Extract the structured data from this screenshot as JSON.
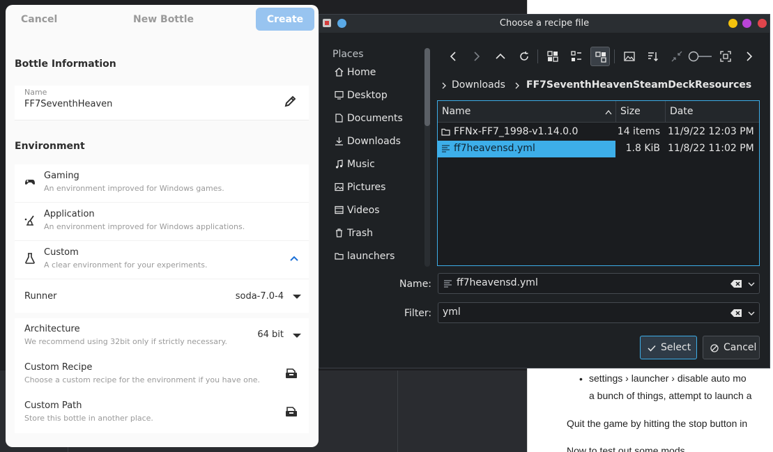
{
  "bottles": {
    "cancel_label": "Cancel",
    "title": "New Bottle",
    "create_label": "Create",
    "bottle_info_heading": "Bottle Information",
    "name_label": "Name",
    "name_value": "FF7SeventhHeaven",
    "environment_heading": "Environment",
    "environments": [
      {
        "title": "Gaming",
        "subtitle": "An environment improved for Windows games.",
        "icon": "gamepad-icon"
      },
      {
        "title": "Application",
        "subtitle": "An environment improved for Windows applications.",
        "icon": "brush-icon"
      },
      {
        "title": "Custom",
        "subtitle": "A clear environment for your experiments.",
        "icon": "flask-icon"
      }
    ],
    "runner_label": "Runner",
    "runner_value": "soda-7.0-4",
    "architecture_label": "Architecture",
    "architecture_sub": "We recommend using 32bit only if strictly necessary.",
    "architecture_value": "64 bit",
    "custom_recipe_label": "Custom Recipe",
    "custom_recipe_sub": "Choose a custom recipe for the environment if you have one.",
    "custom_path_label": "Custom Path",
    "custom_path_sub": "Store this bottle in another place."
  },
  "file_chooser": {
    "title": "Choose a recipe file",
    "places_label": "Places",
    "places": [
      {
        "label": "Home",
        "icon": "home-icon"
      },
      {
        "label": "Desktop",
        "icon": "desktop-icon"
      },
      {
        "label": "Documents",
        "icon": "documents-icon"
      },
      {
        "label": "Downloads",
        "icon": "downloads-icon"
      },
      {
        "label": "Music",
        "icon": "music-icon"
      },
      {
        "label": "Pictures",
        "icon": "pictures-icon"
      },
      {
        "label": "Videos",
        "icon": "videos-icon"
      },
      {
        "label": "Trash",
        "icon": "trash-icon"
      },
      {
        "label": "launchers",
        "icon": "folder-icon"
      }
    ],
    "breadcrumb": [
      "Downloads",
      "FF7SeventhHeavenSteamDeckResources"
    ],
    "columns": {
      "name": "Name",
      "size": "Size",
      "date": "Date"
    },
    "files": [
      {
        "name": "FFNx-FF7_1998-v1.14.0.0",
        "size": "14 items",
        "date": "11/9/22 12:03 PM",
        "type": "folder",
        "selected": false
      },
      {
        "name": "ff7heavensd.yml",
        "size": "1.8 KiB",
        "date": "11/8/22 11:02 PM",
        "type": "file",
        "selected": true
      }
    ],
    "name_label": "Name:",
    "name_value": "ff7heavensd.yml",
    "filter_label": "Filter:",
    "filter_value": "yml",
    "select_label": "Select",
    "cancel_label": "Cancel",
    "colors": {
      "accent": "#3daee9",
      "bg": "#1e2124"
    }
  },
  "web_page": {
    "bullet_text": "settings › launcher › disable auto mo",
    "bullet_cont": "a bunch of things, attempt to launch a",
    "para1": "Quit the game by hitting the stop button in",
    "para2": "Now to test out some mods"
  }
}
